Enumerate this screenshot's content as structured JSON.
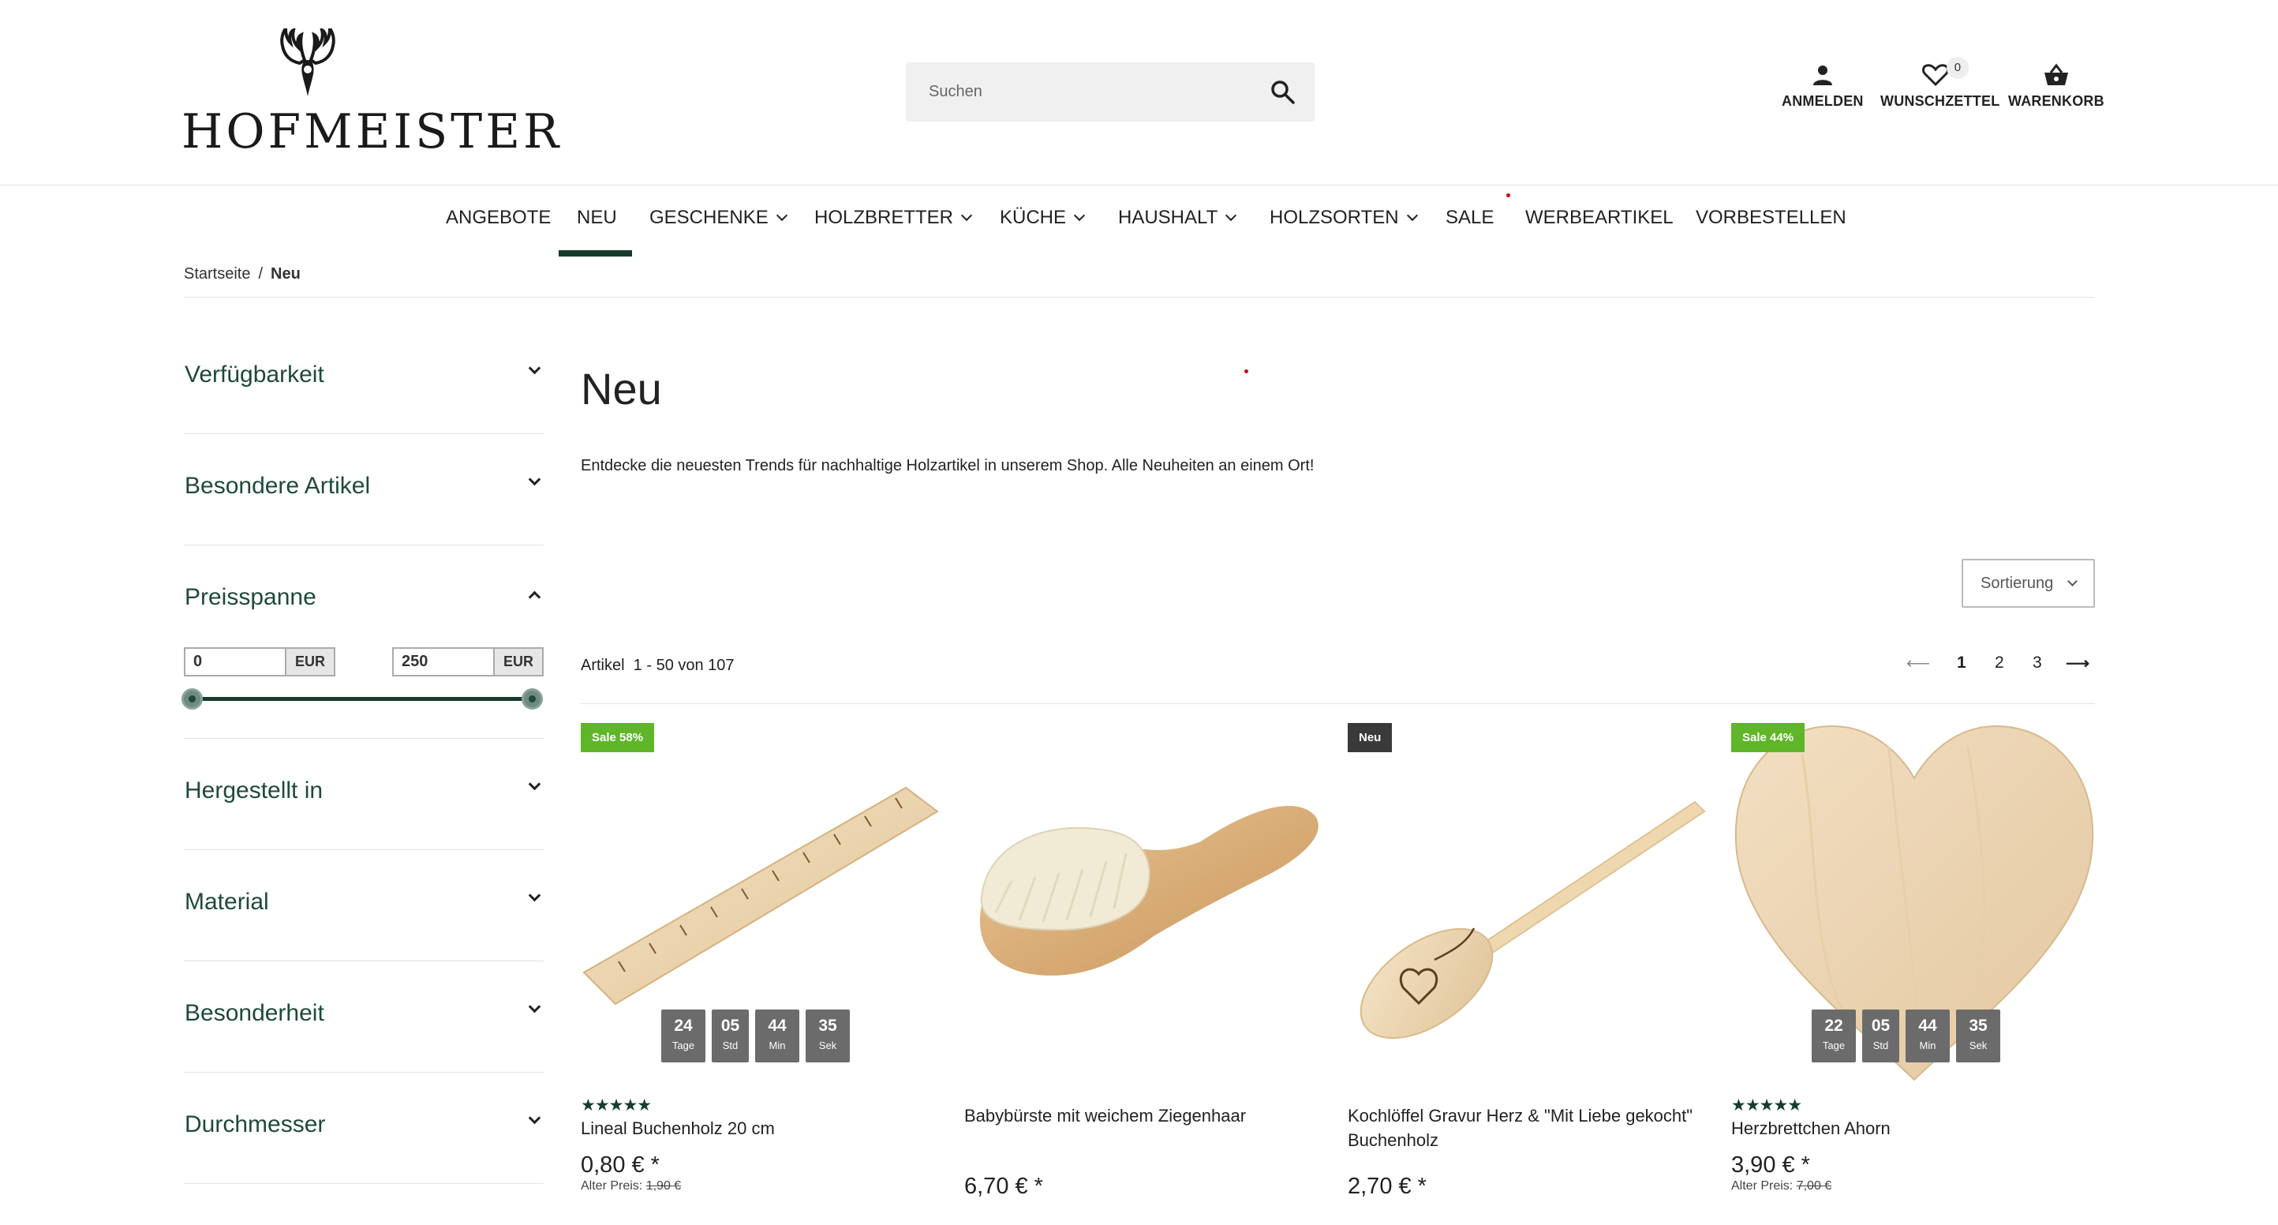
{
  "header": {
    "brand": "HOFMEISTER",
    "search_placeholder": "Suchen",
    "actions": {
      "login": "ANMELDEN",
      "wishlist": "WUNSCHZETTEL",
      "wishlist_count": "0",
      "cart": "WARENKORB"
    }
  },
  "nav": {
    "items": [
      {
        "label": "ANGEBOTE"
      },
      {
        "label": "NEU"
      },
      {
        "label": "GESCHENKE"
      },
      {
        "label": "HOLZBRETTER"
      },
      {
        "label": "KÜCHE"
      },
      {
        "label": "HAUSHALT"
      },
      {
        "label": "HOLZSORTEN"
      },
      {
        "label": "SALE"
      },
      {
        "label": "WERBEARTIKEL"
      },
      {
        "label": "VORBESTELLEN"
      }
    ]
  },
  "breadcrumb": {
    "home": "Startseite",
    "separator": "/",
    "current": "Neu"
  },
  "sidebar": {
    "facets": [
      {
        "title": "Verfügbarkeit"
      },
      {
        "title": "Besondere Artikel"
      },
      {
        "title": "Preisspanne"
      },
      {
        "title": "Hergestellt in"
      },
      {
        "title": "Material"
      },
      {
        "title": "Besonderheit"
      },
      {
        "title": "Durchmesser"
      }
    ],
    "price": {
      "min": "0",
      "max": "250",
      "currency": "EUR"
    }
  },
  "main": {
    "title": "Neu",
    "description": "Entdecke die neuesten Trends für nachhaltige Holzartikel in unserem Shop. Alle Neuheiten an einem Ort!",
    "sort_label": "Sortierung",
    "article_count": "Artikel  1 - 50 von 107",
    "pager": {
      "prev": "⟵",
      "pages": [
        "1",
        "2",
        "3"
      ],
      "next": "⟶"
    }
  },
  "products": [
    {
      "badge": "Sale 58%",
      "countdown": [
        {
          "n": "24",
          "u": "Tage"
        },
        {
          "n": "05",
          "u": "Std"
        },
        {
          "n": "44",
          "u": "Min"
        },
        {
          "n": "35",
          "u": "Sek"
        }
      ],
      "stars": "★★★★★",
      "name": "Lineal Buchenholz 20 cm",
      "price": "0,80 € *",
      "old_price_label": "Alter Preis:",
      "old_price": "1,90 €"
    },
    {
      "name": "Babybürste mit weichem Ziegenhaar",
      "price": "6,70 € *"
    },
    {
      "badge": "Neu",
      "name": "Kochlöffel Gravur Herz & \"Mit Liebe gekocht\" Buchenholz",
      "price": "2,70 € *"
    },
    {
      "badge": "Sale 44%",
      "countdown": [
        {
          "n": "22",
          "u": "Tage"
        },
        {
          "n": "05",
          "u": "Std"
        },
        {
          "n": "44",
          "u": "Min"
        },
        {
          "n": "35",
          "u": "Sek"
        }
      ],
      "stars": "★★★★★",
      "name": "Herzbrettchen Ahorn",
      "price": "3,90 € *",
      "old_price_label": "Alter Preis:",
      "old_price": "7,00 €"
    }
  ],
  "colors": {
    "brand_green": "#163d2c",
    "sale_badge": "#5fb629",
    "new_badge": "#3a3a3a"
  }
}
